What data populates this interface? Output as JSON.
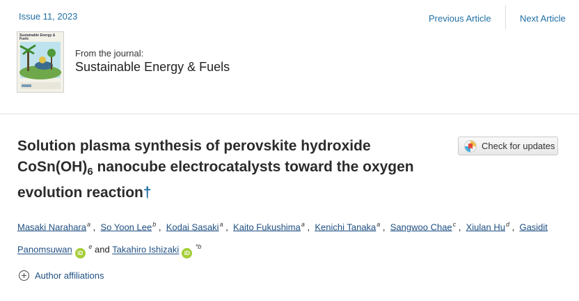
{
  "header": {
    "issue": "Issue 11, 2023",
    "previous": "Previous Article",
    "next": "Next Article"
  },
  "journal": {
    "from_label": "From the journal:",
    "name": "Sustainable Energy & Fuels",
    "cover_title": "Sustainable Energy & Fuels"
  },
  "article": {
    "title_part1": "Solution plasma synthesis of perovskite hydroxide CoSn(OH)",
    "title_sub": "6",
    "title_part2": " nanocube electrocatalysts toward the oxygen evolution reaction",
    "dagger": "†",
    "check_updates": "Check for updates"
  },
  "authors": [
    {
      "name": "Masaki Narahara",
      "aff": "a"
    },
    {
      "name": "So Yoon Lee",
      "aff": "b"
    },
    {
      "name": "Kodai Sasaki",
      "aff": "a"
    },
    {
      "name": "Kaito Fukushima",
      "aff": "a"
    },
    {
      "name": "Kenichi Tanaka",
      "aff": "a"
    },
    {
      "name": "Sangwoo Chae",
      "aff": "c"
    },
    {
      "name": "Xiulan Hu",
      "aff": "d"
    },
    {
      "name": "Gasidit Panomsuwan",
      "aff": "e"
    },
    {
      "name": "Takahiro Ishizaki",
      "aff": "*b"
    }
  ],
  "and_word": "and",
  "affiliations_label": "Author affiliations",
  "colors": {
    "link": "#1f6fa3",
    "orcid": "#a6ce39"
  }
}
